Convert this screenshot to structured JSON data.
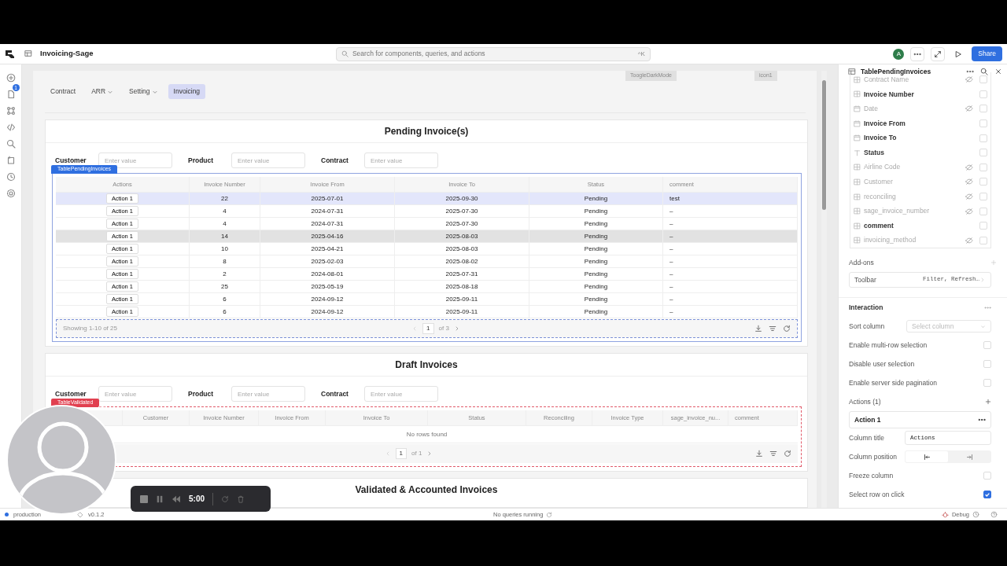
{
  "app": {
    "title": "Invoicing-Sage",
    "search_placeholder": "Search for components, queries, and actions",
    "search_shortcut": "^K",
    "avatar": "A",
    "share": "Share"
  },
  "rail": {
    "badge": "1"
  },
  "nav": [
    {
      "label": "Contract",
      "dropdown": false,
      "selected": false
    },
    {
      "label": "ARR",
      "dropdown": true,
      "selected": false
    },
    {
      "label": "Setting",
      "dropdown": true,
      "selected": false
    },
    {
      "label": "Invoicing",
      "dropdown": false,
      "selected": true
    }
  ],
  "canvas_tags": [
    "ToogleDarkMode",
    "icon1"
  ],
  "pending": {
    "title": "Pending Invoice(s)",
    "filters": [
      {
        "label": "Customer",
        "placeholder": "Enter value"
      },
      {
        "label": "Product",
        "placeholder": "Enter value"
      },
      {
        "label": "Contract",
        "placeholder": "Enter value"
      }
    ],
    "table_tag": "TablePendingInvoices",
    "columns": [
      "Actions",
      "Invoice Number",
      "Invoice From",
      "Invoice To",
      "Status",
      "comment"
    ],
    "rows": [
      {
        "cells": [
          "Action 1",
          "22",
          "2025-07-01",
          "2025-09-30",
          "Pending",
          "test"
        ],
        "selected": true,
        "hovered": false
      },
      {
        "cells": [
          "Action 1",
          "4",
          "2024-07-31",
          "2025-07-30",
          "Pending",
          "–"
        ],
        "selected": false,
        "hovered": false
      },
      {
        "cells": [
          "Action 1",
          "4",
          "2024-07-31",
          "2025-07-30",
          "Pending",
          "–"
        ],
        "selected": false,
        "hovered": false
      },
      {
        "cells": [
          "Action 1",
          "14",
          "2025-04-16",
          "2025-08-03",
          "Pending",
          "–"
        ],
        "selected": false,
        "hovered": true
      },
      {
        "cells": [
          "Action 1",
          "10",
          "2025-04-21",
          "2025-08-03",
          "Pending",
          "–"
        ],
        "selected": false,
        "hovered": false
      },
      {
        "cells": [
          "Action 1",
          "8",
          "2025-02-03",
          "2025-08-02",
          "Pending",
          "–"
        ],
        "selected": false,
        "hovered": false
      },
      {
        "cells": [
          "Action 1",
          "2",
          "2024-08-01",
          "2025-07-31",
          "Pending",
          "–"
        ],
        "selected": false,
        "hovered": false
      },
      {
        "cells": [
          "Action 1",
          "25",
          "2025-05-19",
          "2025-08-18",
          "Pending",
          "–"
        ],
        "selected": false,
        "hovered": false
      },
      {
        "cells": [
          "Action 1",
          "6",
          "2024-09-12",
          "2025-09-11",
          "Pending",
          "–"
        ],
        "selected": false,
        "hovered": false
      },
      {
        "cells": [
          "Action 1",
          "6",
          "2024-09-12",
          "2025-09-11",
          "Pending",
          "–"
        ],
        "selected": false,
        "hovered": false
      }
    ],
    "footer": "Showing 1-10 of 25",
    "page": "1",
    "page_of": "of 3"
  },
  "draft": {
    "title": "Draft Invoices",
    "filters": [
      {
        "label": "Customer",
        "placeholder": "Enter value"
      },
      {
        "label": "Product",
        "placeholder": "Enter value"
      },
      {
        "label": "Contract",
        "placeholder": "Enter value"
      }
    ],
    "table_tag": "TableValidated",
    "columns": [
      "Customer",
      "Invoice Number",
      "Invoice From",
      "Invoice To",
      "Status",
      "Reconciling",
      "Invoice Type",
      "sage_invoice_nu...",
      "comment"
    ],
    "empty": "No rows found",
    "page": "1",
    "page_of": "of 1"
  },
  "next_title": "Validated & Accounted Invoices",
  "panel": {
    "title": "TablePendingInvoices",
    "columns": [
      {
        "label": "Contract Name",
        "kind": "table",
        "hidden": true
      },
      {
        "label": "Invoice Number",
        "kind": "table",
        "hidden": false
      },
      {
        "label": "Date",
        "kind": "date",
        "hidden": true
      },
      {
        "label": "Invoice From",
        "kind": "date",
        "hidden": false
      },
      {
        "label": "Invoice To",
        "kind": "date",
        "hidden": false
      },
      {
        "label": "Status",
        "kind": "text",
        "hidden": false
      },
      {
        "label": "Airline Code",
        "kind": "table",
        "hidden": true
      },
      {
        "label": "Customer",
        "kind": "table",
        "hidden": true
      },
      {
        "label": "reconciling",
        "kind": "table",
        "hidden": true
      },
      {
        "label": "sage_invoice_number",
        "kind": "table",
        "hidden": true
      },
      {
        "label": "comment",
        "kind": "table",
        "hidden": false
      },
      {
        "label": "invoicing_method",
        "kind": "table",
        "hidden": true
      }
    ],
    "addons_title": "Add-ons",
    "toolbar": {
      "label": "Toolbar",
      "value": "Filter, Refresh…"
    },
    "interaction_title": "Interaction",
    "settings": [
      {
        "kind": "select",
        "label": "Sort column",
        "placeholder": "Select column"
      },
      {
        "kind": "checkbox",
        "label": "Enable multi-row selection",
        "checked": false
      },
      {
        "kind": "checkbox",
        "label": "Disable user selection",
        "checked": false
      },
      {
        "kind": "checkbox",
        "label": "Enable server side pagination",
        "checked": false
      }
    ],
    "actions_title": "Actions (1)",
    "action_item": "Action 1",
    "column_title": {
      "label": "Column title",
      "value": "Actions"
    },
    "column_position": {
      "label": "Column position",
      "options": [
        {
          "selected": true
        },
        {
          "selected": false
        }
      ]
    },
    "settings2": [
      {
        "kind": "checkbox",
        "label": "Freeze column",
        "checked": false
      },
      {
        "kind": "checkbox",
        "label": "Select row on click",
        "checked": true
      }
    ]
  },
  "status_bar": {
    "env": "production",
    "version": "v0.1.2",
    "queries": "No queries running",
    "debug": "Debug"
  },
  "recorder": {
    "time": "5:00"
  }
}
